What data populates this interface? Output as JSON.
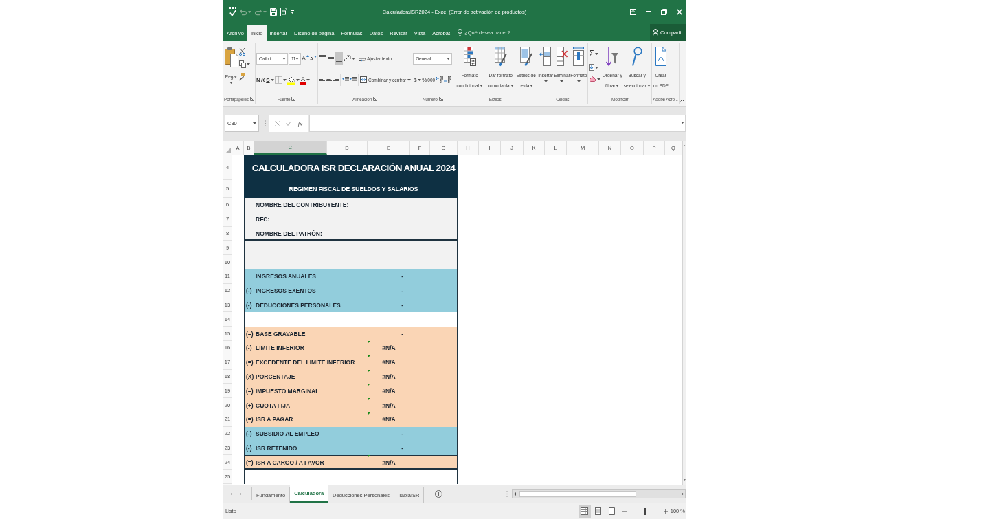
{
  "window": {
    "title": "CalculadoraISR2024 - Excel (Error de activación de productos)"
  },
  "quick_access": [
    {
      "kind": "spelling",
      "disabled": false
    },
    {
      "kind": "undo",
      "disabled": true
    },
    {
      "kind": "redo",
      "disabled": true
    },
    {
      "kind": "save",
      "disabled": false
    },
    {
      "kind": "preview",
      "disabled": false
    }
  ],
  "ribbon_tabs": [
    {
      "label": "Archivo",
      "selected": false
    },
    {
      "label": "Inicio",
      "selected": true
    },
    {
      "label": "Insertar",
      "selected": false
    },
    {
      "label": "Diseño de página",
      "selected": false
    },
    {
      "label": "Fórmulas",
      "selected": false
    },
    {
      "label": "Datos",
      "selected": false
    },
    {
      "label": "Revisar",
      "selected": false
    },
    {
      "label": "Vista",
      "selected": false
    },
    {
      "label": "Acrobat",
      "selected": false
    }
  ],
  "tell_me": {
    "placeholder": "¿Qué desea hacer?"
  },
  "share_button": {
    "label": "Compartir"
  },
  "ribbon": {
    "clipboard": {
      "label": "Portapapeles",
      "paste_button": "Pegar"
    },
    "font": {
      "label": "Fuente",
      "font_name": "Calibri",
      "font_size": "11",
      "grow_button": "A",
      "shrink_button": "A",
      "bold_button": "N",
      "italic_button": "K",
      "underline_button": "S",
      "font_color_button": "A"
    },
    "alignment": {
      "label": "Alineación",
      "vertical": [
        {
          "kind": "top",
          "selected": false
        },
        {
          "kind": "middle",
          "selected": false
        },
        {
          "kind": "bottom",
          "selected": true
        }
      ],
      "wrap_button": "Ajustar texto",
      "merge_button": "Combinar y centrar"
    },
    "number": {
      "label": "Número",
      "format": "General",
      "currency_button": "$",
      "percent_button": "%",
      "thousands_button": "000"
    },
    "styles": {
      "label": "Estilos",
      "buttons": [
        {
          "kind": "conditional",
          "label": "Formato condicional"
        },
        {
          "kind": "table",
          "label": "Dar formato como tabla"
        },
        {
          "kind": "cell",
          "label": "Estilos de celda"
        }
      ]
    },
    "cells": {
      "label": "Celdas",
      "buttons": [
        {
          "kind": "insert",
          "label": "Insertar"
        },
        {
          "kind": "delete",
          "label": "Eliminar"
        },
        {
          "kind": "format",
          "label": "Formato"
        }
      ]
    },
    "editing": {
      "label": "Modificar",
      "autosum_button": "Σ",
      "buttons": [
        {
          "kind": "sort",
          "label": "Ordenar y filtrar"
        },
        {
          "kind": "find",
          "label": "Buscar y seleccionar"
        }
      ]
    },
    "adobe": {
      "label": "Adobe Acro...",
      "button": "Crear un PDF"
    }
  },
  "formula_bar": {
    "name_box": "C30",
    "function_button": "fx"
  },
  "columns": [
    {
      "label": "A",
      "selected": false
    },
    {
      "label": "B",
      "selected": false
    },
    {
      "label": "C",
      "selected": true
    },
    {
      "label": "D",
      "selected": false
    },
    {
      "label": "E",
      "selected": false
    },
    {
      "label": "F",
      "selected": false
    },
    {
      "label": "G",
      "selected": false
    },
    {
      "label": "H",
      "selected": false
    },
    {
      "label": "I",
      "selected": false
    },
    {
      "label": "J",
      "selected": false
    },
    {
      "label": "K",
      "selected": false
    },
    {
      "label": "L",
      "selected": false
    },
    {
      "label": "M",
      "selected": false
    },
    {
      "label": "N",
      "selected": false
    },
    {
      "label": "O",
      "selected": false
    },
    {
      "label": "P",
      "selected": false
    },
    {
      "label": "Q",
      "selected": false
    }
  ],
  "sheet": {
    "sections": [
      {
        "kind": "banner",
        "color": "#0e3043",
        "rows": [
          {
            "number": "4",
            "text": "CALCULADORA ISR DECLARACIÓN ANUAL 2024"
          },
          {
            "number": "5",
            "text": "RÉGIMEN FISCAL DE SUELDOS Y SALARIOS"
          }
        ]
      },
      {
        "kind": "fields",
        "color": "#f2f2f2",
        "rows": [
          {
            "number": "6",
            "label": "NOMBRE DEL CONTRIBUYENTE:"
          },
          {
            "number": "7",
            "label": "RFC:"
          },
          {
            "number": "8",
            "label": "NOMBRE DEL PATRÓN:"
          }
        ]
      },
      {
        "kind": "spacer",
        "color": "#f2f2f2",
        "rows": [
          {
            "number": "9"
          },
          {
            "number": "10"
          }
        ]
      },
      {
        "kind": "lines",
        "color": "#92cddc",
        "rows": [
          {
            "number": "11",
            "label": "INGRESOS ANUALES",
            "value": "-",
            "flagged": false
          },
          {
            "number": "12",
            "operator": "(-)",
            "label": "INGRESOS EXENTOS",
            "value": "-",
            "flagged": false
          },
          {
            "number": "13",
            "operator": "(-)",
            "label": "DEDUCCIONES PERSONALES",
            "value": "-",
            "flagged": false
          }
        ]
      },
      {
        "kind": "spacer",
        "color": "#ffffff",
        "rows": [
          {
            "number": "14"
          }
        ]
      },
      {
        "kind": "lines",
        "color": "#fad5b5",
        "rows": [
          {
            "number": "15",
            "operator": "(=)",
            "label": "BASE GRAVABLE",
            "value": "-",
            "flagged": false
          },
          {
            "number": "16",
            "operator": "(-)",
            "label": "LIMITE INFERIOR",
            "value": "#N/A",
            "flagged": true
          },
          {
            "number": "17",
            "operator": "(=)",
            "label": "EXCEDENTE DEL LIMITE INFERIOR",
            "value": "#N/A",
            "flagged": true
          },
          {
            "number": "18",
            "operator": "(X)",
            "label": "PORCENTAJE",
            "value": "#N/A",
            "flagged": true
          },
          {
            "number": "19",
            "operator": "(=)",
            "label": "IMPUESTO MARGINAL",
            "value": "#N/A",
            "flagged": true
          },
          {
            "number": "20",
            "operator": "(+)",
            "label": "CUOTA FIJA",
            "value": "#N/A",
            "flagged": true
          },
          {
            "number": "21",
            "operator": "(=)",
            "label": "ISR A PAGAR",
            "value": "#N/A",
            "flagged": true
          }
        ]
      },
      {
        "kind": "lines",
        "color": "#92cddc",
        "rows": [
          {
            "number": "22",
            "operator": "(-)",
            "label": "SUBSIDIO AL EMPLEO",
            "value": "-",
            "flagged": false
          },
          {
            "number": "23",
            "operator": "(-)",
            "label": "ISR RETENIDO",
            "value": "-",
            "flagged": false
          }
        ]
      },
      {
        "kind": "total",
        "color": "#fad5b5",
        "rows": [
          {
            "number": "24",
            "operator": "(=)",
            "label": "ISR A CARGO / A FAVOR",
            "value": "#N/A",
            "flagged": true
          }
        ]
      },
      {
        "kind": "spacer",
        "color": "#ffffff",
        "rows": [
          {
            "number": "25"
          }
        ]
      }
    ]
  },
  "sheet_tabs": [
    {
      "label": "Fundamento",
      "selected": false
    },
    {
      "label": "Calculadora",
      "selected": true
    },
    {
      "label": "Deducciones Personales",
      "selected": false
    },
    {
      "label": "TablaISR",
      "selected": false
    }
  ],
  "status_bar": {
    "text": "Listo",
    "views": [
      {
        "kind": "normal",
        "selected": true
      },
      {
        "kind": "page_layout",
        "selected": false
      },
      {
        "kind": "page_break",
        "selected": false
      }
    ],
    "zoom": {
      "level": 0.5,
      "reading": "100 %"
    }
  }
}
